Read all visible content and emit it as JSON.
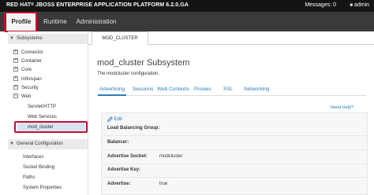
{
  "header": {
    "brand_prefix": "RED HAT",
    "brand_rest": "JBOSS ENTERPRISE APPLICATION PLATFORM 6.2.0.GA",
    "messages": "Messages: 0",
    "user": "admin"
  },
  "nav": {
    "tabs": [
      {
        "label": "Profile"
      },
      {
        "label": "Runtime"
      },
      {
        "label": "Administration"
      }
    ]
  },
  "sidebar": {
    "subsystems_header": "Subsystems",
    "tree": [
      {
        "label": "Connector",
        "expander": "+"
      },
      {
        "label": "Container",
        "expander": "+"
      },
      {
        "label": "Core",
        "expander": "+"
      },
      {
        "label": "Infinispan",
        "expander": "+"
      },
      {
        "label": "Security",
        "expander": "+"
      },
      {
        "label": "Web",
        "expander": "−"
      }
    ],
    "web_children": [
      "Servlet/HTTP",
      "Web Services",
      "mod_cluster"
    ],
    "general_header": "General Configuration",
    "general_items": [
      "Interfaces",
      "Socket Binding",
      "Paths",
      "System Properties"
    ]
  },
  "main": {
    "page_tab": "MOD_CLUSTER",
    "title": "mod_cluster Subsystem",
    "description": "The modcluster configuration.",
    "subtabs": [
      "Advertising",
      "Sessions",
      "Web Contexts",
      "Proxies",
      "SSL",
      "Networking"
    ],
    "need_help": "Need Help?",
    "edit": "Edit",
    "fields": [
      {
        "label": "Load Balancing Group:",
        "value": ""
      },
      {
        "label": "Balancer:",
        "value": ""
      },
      {
        "label": "Advertise Socket:",
        "value": "modcluster"
      },
      {
        "label": "Advertise Key:",
        "value": ""
      },
      {
        "label": "Advertise:",
        "value": "true"
      }
    ]
  },
  "colors": {
    "highlight_box": "#c8102e",
    "link": "#2b7bb9",
    "topbar": "#141414",
    "navbar": "#3a3a3a"
  }
}
